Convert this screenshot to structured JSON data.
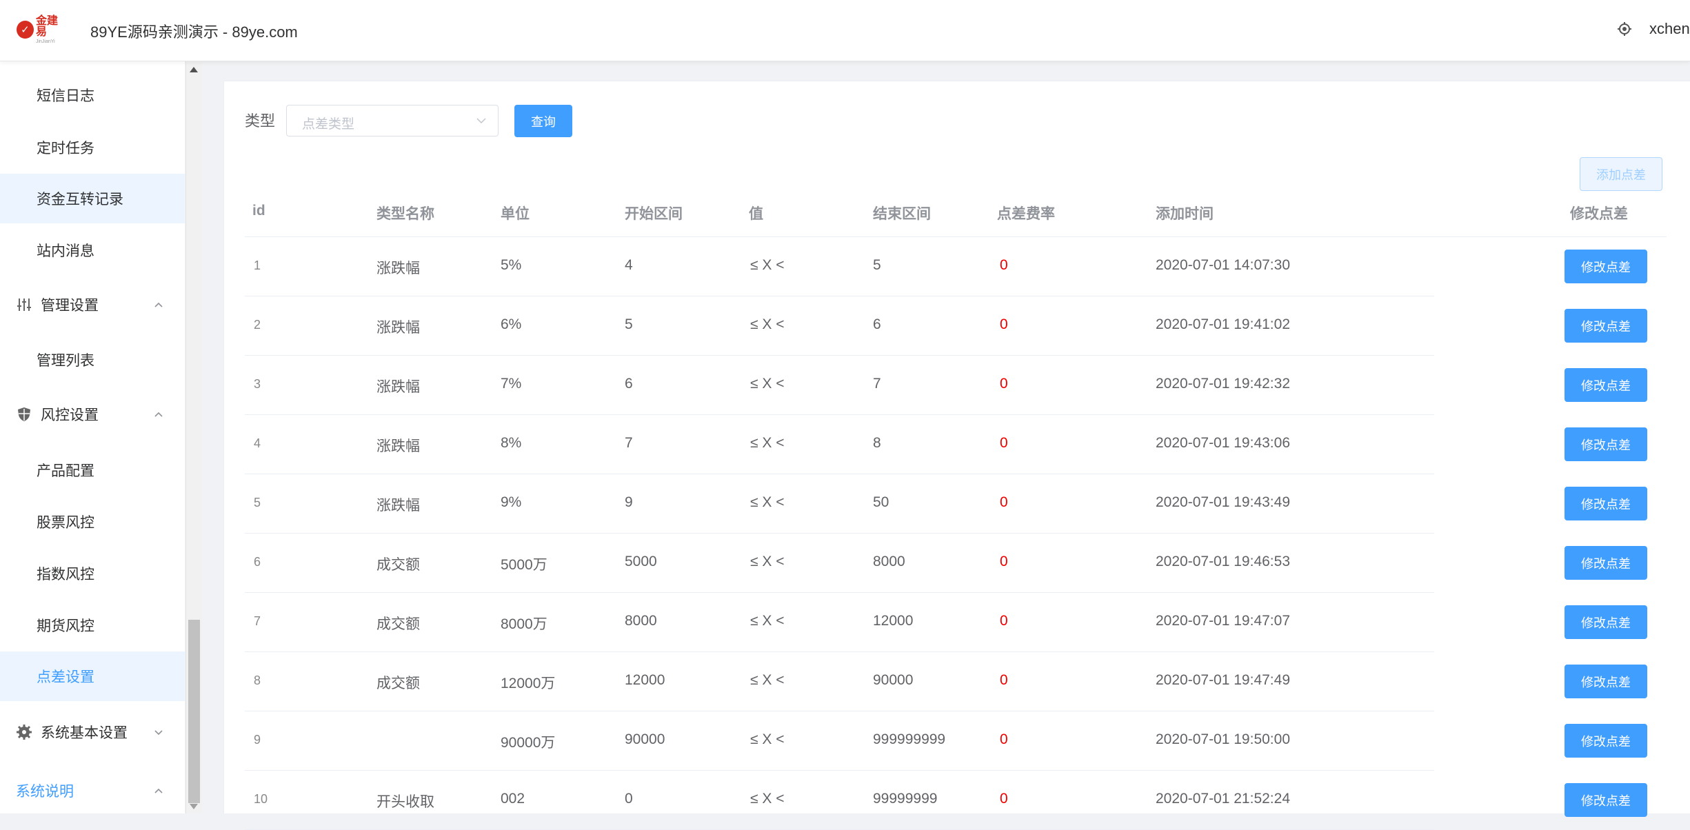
{
  "header": {
    "logo_cn": "金建易",
    "logo_en": "JinJianYi",
    "site_title": "89YE源码亲测演示 - 89ye.com",
    "user": "xchen",
    "icon": "gear-icon"
  },
  "sidebar": {
    "items": [
      {
        "label": "短信日志",
        "kind": "sub"
      },
      {
        "label": "定时任务",
        "kind": "sub"
      },
      {
        "label": "资金互转记录",
        "kind": "sub",
        "highlight": true
      },
      {
        "label": "站内消息",
        "kind": "sub"
      },
      {
        "label": "管理设置",
        "kind": "group",
        "icon": "sliders-icon",
        "expanded": true
      },
      {
        "label": "管理列表",
        "kind": "sub"
      },
      {
        "label": "风控设置",
        "kind": "group",
        "icon": "shield-icon",
        "expanded": true
      },
      {
        "label": "产品配置",
        "kind": "sub"
      },
      {
        "label": "股票风控",
        "kind": "sub"
      },
      {
        "label": "指数风控",
        "kind": "sub"
      },
      {
        "label": "期货风控",
        "kind": "sub"
      },
      {
        "label": "点差设置",
        "kind": "sub",
        "active": true
      },
      {
        "label": "系统基本设置",
        "kind": "group",
        "icon": "gear-icon",
        "expanded": false
      },
      {
        "label": "系统说明",
        "kind": "link",
        "expanded": true
      }
    ]
  },
  "filter": {
    "label": "类型",
    "placeholder": "点差类型",
    "query_button": "查询"
  },
  "actions": {
    "add_button": "添加点差"
  },
  "table": {
    "columns": [
      "id",
      "类型名称",
      "单位",
      "开始区间",
      "值",
      "结束区间",
      "点差费率",
      "添加时间",
      "修改点差"
    ],
    "edit_label": "修改点差",
    "rows": [
      {
        "id": "1",
        "type": "涨跌幅",
        "unit": "5%",
        "start": "4",
        "value": "≤ X <",
        "end": "5",
        "rate": "0",
        "time": "2020-07-01 14:07:30"
      },
      {
        "id": "2",
        "type": "涨跌幅",
        "unit": "6%",
        "start": "5",
        "value": "≤ X <",
        "end": "6",
        "rate": "0",
        "time": "2020-07-01 19:41:02"
      },
      {
        "id": "3",
        "type": "涨跌幅",
        "unit": "7%",
        "start": "6",
        "value": "≤ X <",
        "end": "7",
        "rate": "0",
        "time": "2020-07-01 19:42:32"
      },
      {
        "id": "4",
        "type": "涨跌幅",
        "unit": "8%",
        "start": "7",
        "value": "≤ X <",
        "end": "8",
        "rate": "0",
        "time": "2020-07-01 19:43:06"
      },
      {
        "id": "5",
        "type": "涨跌幅",
        "unit": "9%",
        "start": "9",
        "value": "≤ X <",
        "end": "50",
        "rate": "0",
        "time": "2020-07-01 19:43:49"
      },
      {
        "id": "6",
        "type": "成交额",
        "unit": "5000万",
        "start": "5000",
        "value": "≤ X <",
        "end": "8000",
        "rate": "0",
        "time": "2020-07-01 19:46:53"
      },
      {
        "id": "7",
        "type": "成交额",
        "unit": "8000万",
        "start": "8000",
        "value": "≤ X <",
        "end": "12000",
        "rate": "0",
        "time": "2020-07-01 19:47:07"
      },
      {
        "id": "8",
        "type": "成交额",
        "unit": "12000万",
        "start": "12000",
        "value": "≤ X <",
        "end": "90000",
        "rate": "0",
        "time": "2020-07-01 19:47:49"
      },
      {
        "id": "9",
        "type": "",
        "unit": "90000万",
        "start": "90000",
        "value": "≤ X <",
        "end": "999999999",
        "rate": "0",
        "time": "2020-07-01 19:50:00"
      },
      {
        "id": "10",
        "type": "开头收取",
        "unit": "002",
        "start": "0",
        "value": "≤ X <",
        "end": "99999999",
        "rate": "0",
        "time": "2020-07-01 21:52:24"
      }
    ]
  },
  "colors": {
    "primary": "#409eff",
    "rate_red": "#e00000",
    "active_bg": "#ecf5ff"
  }
}
